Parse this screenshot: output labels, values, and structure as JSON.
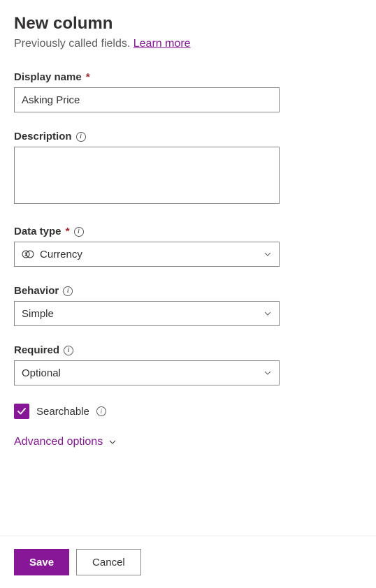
{
  "header": {
    "title": "New column",
    "subtitle_prefix": "Previously called fields. ",
    "learn_more": "Learn more"
  },
  "fields": {
    "display_name": {
      "label": "Display name",
      "value": "Asking Price"
    },
    "description": {
      "label": "Description",
      "value": ""
    },
    "data_type": {
      "label": "Data type",
      "value": "Currency"
    },
    "behavior": {
      "label": "Behavior",
      "value": "Simple"
    },
    "required": {
      "label": "Required",
      "value": "Optional"
    },
    "searchable": {
      "label": "Searchable",
      "checked": true
    }
  },
  "advanced": {
    "label": "Advanced options"
  },
  "footer": {
    "save": "Save",
    "cancel": "Cancel"
  },
  "colors": {
    "accent": "#881798"
  }
}
